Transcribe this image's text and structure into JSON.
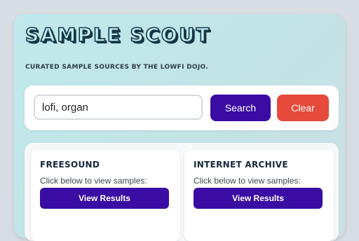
{
  "app": {
    "title": "Sample Scout",
    "subtitle": "Curated sample sources by the Lowfi Dojo."
  },
  "search": {
    "value": "lofi, organ",
    "search_label": "Search",
    "clear_label": "Clear"
  },
  "sources": [
    {
      "name": "FREESOUND",
      "hint": "Click below to view samples:",
      "button_label": "View Results"
    },
    {
      "name": "INTERNET ARCHIVE",
      "hint": "Click below to view samples:",
      "button_label": "View Results"
    }
  ],
  "colors": {
    "primary": "#3a0ca3",
    "danger": "#e64a3b",
    "title_fill": "#bff0f6",
    "title_outline": "#163645",
    "panel_bg": "#c3e3e6"
  }
}
